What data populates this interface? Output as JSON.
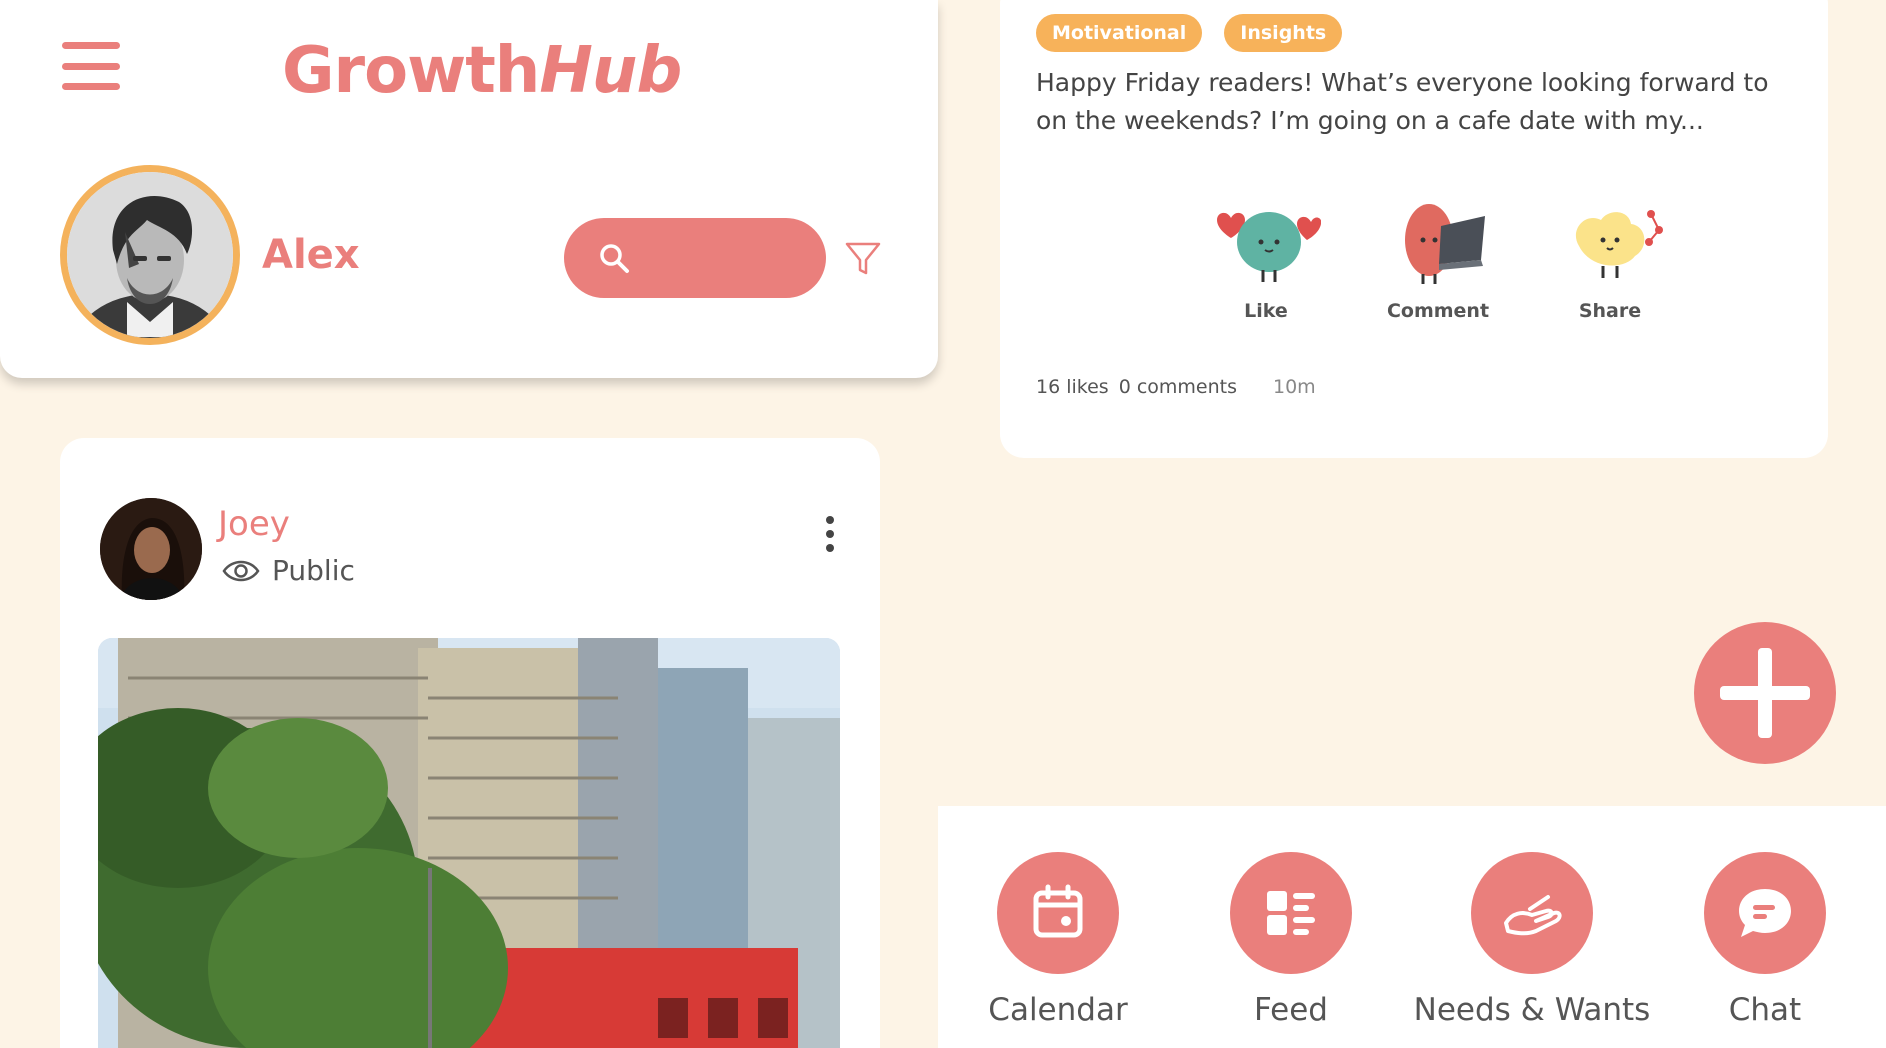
{
  "app": {
    "brand_main": "Growth",
    "brand_accent": "Hub",
    "accent_color": "#ea7f7c",
    "tag_color": "#f7b25a",
    "background": "#fdf4e6"
  },
  "header": {
    "menu_icon": "hamburger-menu-icon",
    "user_name": "Alex",
    "search_placeholder": "",
    "search_icon": "search-icon",
    "filter_icon": "filter-icon"
  },
  "post": {
    "author": "Joey",
    "visibility": "Public",
    "visibility_icon": "eye-icon",
    "more_icon": "more-vertical-icon"
  },
  "featured_post": {
    "tags": [
      "Motivational",
      "Insights"
    ],
    "text": "Happy Friday readers! What’s everyone looking forward to on the weekends? I’m going on a cafe date with my...",
    "reactions": [
      {
        "label": "Like",
        "icon": "like-mascot-icon"
      },
      {
        "label": "Comment",
        "icon": "comment-mascot-icon"
      },
      {
        "label": "Share",
        "icon": "share-mascot-icon"
      }
    ],
    "likes": "16 likes",
    "comments": "0 comments",
    "time": "10m"
  },
  "fab": {
    "icon": "plus-icon"
  },
  "bottom_nav": [
    {
      "label": "Calendar",
      "icon": "calendar-icon"
    },
    {
      "label": "Feed",
      "icon": "feed-icon"
    },
    {
      "label": "Needs & Wants",
      "icon": "hand-icon"
    },
    {
      "label": "Chat",
      "icon": "chat-icon"
    }
  ]
}
